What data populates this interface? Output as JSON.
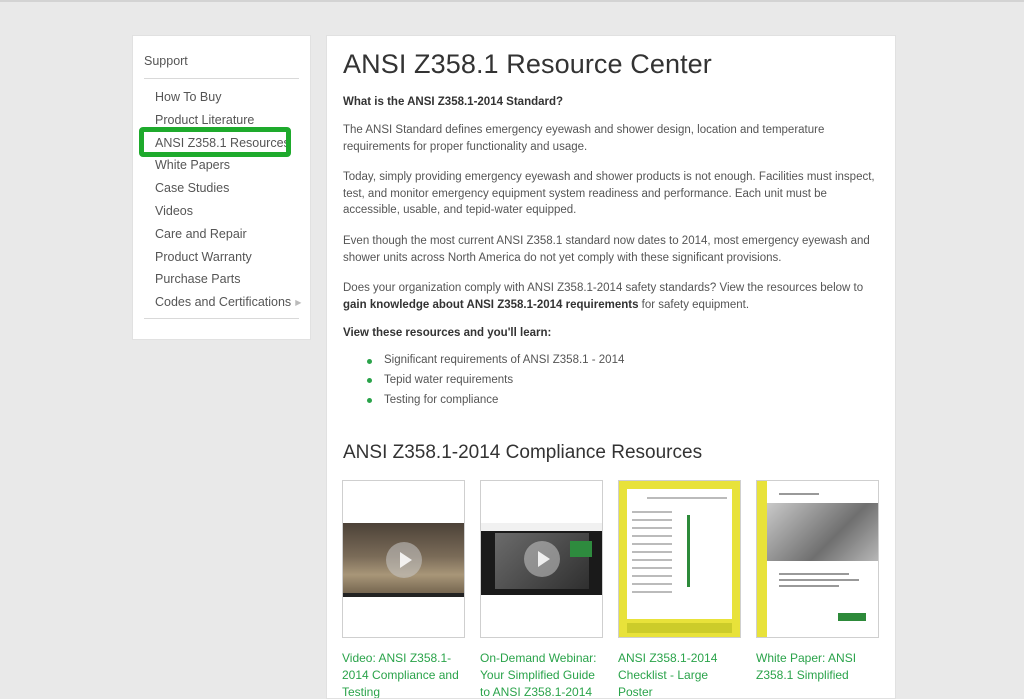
{
  "sidebar": {
    "title": "Support",
    "items": [
      {
        "label": "How To Buy"
      },
      {
        "label": "Product Literature"
      },
      {
        "label": "ANSI Z358.1 Resources"
      },
      {
        "label": "White Papers"
      },
      {
        "label": "Case Studies"
      },
      {
        "label": "Videos"
      },
      {
        "label": "Care and Repair"
      },
      {
        "label": "Product Warranty"
      },
      {
        "label": "Purchase Parts"
      },
      {
        "label": "Codes and Certifications"
      }
    ],
    "highlight_color": "#1eaa2c"
  },
  "main": {
    "title": "ANSI Z358.1 Resource Center",
    "question": "What is the ANSI Z358.1-2014 Standard?",
    "para1": "The ANSI Standard defines emergency eyewash and shower design, location and temperature requirements for proper functionality and usage.",
    "para2": "Today, simply providing emergency eyewash and shower products is not enough. Facilities must inspect, test, and monitor emergency equipment system readiness and performance. Each unit must be accessible, usable, and tepid-water equipped.",
    "para3": "Even though the most current ANSI Z358.1 standard now dates to 2014, most emergency eyewash and shower units across North America do not yet comply with these significant provisions.",
    "para4_start": "Does your organization comply with ANSI Z358.1-2014 safety standards? View the resources below to ",
    "para4_bold": "gain knowledge about ANSI Z358.1-2014 requirements",
    "para4_end": " for safety equipment.",
    "learn_head": "View these resources and you'll learn:",
    "learn_items": [
      "Significant requirements of ANSI Z358.1 - 2014",
      "Tepid water requirements",
      "Testing for compliance"
    ],
    "section_title": "ANSI Z358.1-2014 Compliance Resources",
    "cards": [
      {
        "caption": "Video: ANSI Z358.1-2014 Compliance and Testing"
      },
      {
        "caption": "On-Demand Webinar: Your Simplified Guide to ANSI Z358.1-2014"
      },
      {
        "caption": "ANSI Z358.1-2014 Checklist - Large Poster"
      },
      {
        "caption": "White Paper:  ANSI Z358.1 Simplified"
      }
    ],
    "accent_color": "#2aa34a"
  }
}
